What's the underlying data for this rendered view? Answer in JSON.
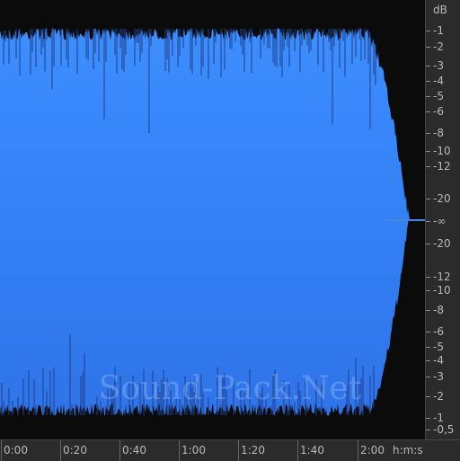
{
  "app": {
    "title": "Waveform display"
  },
  "colors": {
    "background": "#0b0b0b",
    "waveform_top": "#3c8cff",
    "waveform_bottom": "#2f73e6",
    "waveform_spikes": "#1a3d8f",
    "axis_panel": "#2b2b2b",
    "axis_text": "#b8b8b8"
  },
  "db_scale": {
    "unit": "dB",
    "labels": [
      "-1",
      "-2",
      "-3",
      "-4",
      "-5",
      "-6",
      "-8",
      "-10",
      "-12",
      "-20",
      "-∞",
      "-20",
      "-12",
      "-10",
      "-8",
      "-6",
      "-5",
      "-4",
      "-3",
      "-2",
      "-1",
      "-0,5"
    ]
  },
  "time_scale": {
    "unit": "h:m:s",
    "labels": [
      "0:00",
      "0:20",
      "0:40",
      "1:00",
      "1:20",
      "1:40",
      "2:00"
    ]
  },
  "watermark": {
    "text": "Sound-Pack.Net"
  }
}
